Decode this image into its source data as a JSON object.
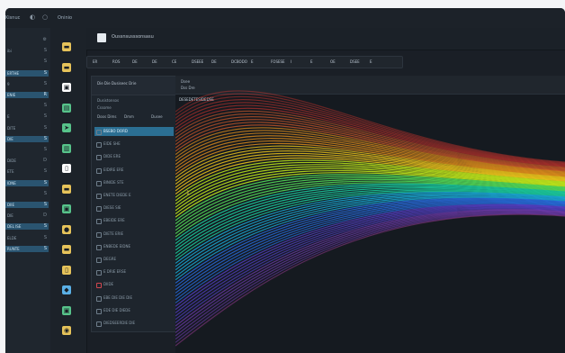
{
  "topbar": {
    "left_label": "Kisnuc",
    "center_label": "Oninio",
    "icons": [
      "moon-icon",
      "circle-icon"
    ]
  },
  "left_nav": {
    "items": [
      {
        "label": "",
        "icon": "gear-icon",
        "highlight": false
      },
      {
        "label": "ibi",
        "icon": "S",
        "highlight": false
      },
      {
        "label": "",
        "icon": "S",
        "highlight": false
      },
      {
        "label": "ERTHE",
        "icon": "S",
        "highlight": true
      },
      {
        "label": "9",
        "icon": "S",
        "highlight": false
      },
      {
        "label": "ENIE",
        "icon": "R",
        "highlight": true
      },
      {
        "label": "",
        "icon": "S",
        "highlight": false
      },
      {
        "label": "E",
        "icon": "S",
        "highlight": false
      },
      {
        "label": "DITE",
        "icon": "S",
        "highlight": false
      },
      {
        "label": "DIE",
        "icon": "S",
        "highlight": true
      },
      {
        "label": "",
        "icon": "S",
        "highlight": false
      },
      {
        "label": "DIDE",
        "icon": "D",
        "highlight": false
      },
      {
        "label": "ETE",
        "icon": "S",
        "highlight": false
      },
      {
        "label": "IDNE",
        "icon": "S",
        "highlight": true
      },
      {
        "label": "",
        "icon": "S",
        "highlight": false
      },
      {
        "label": "DIIE",
        "icon": "S",
        "highlight": true
      },
      {
        "label": "DIE",
        "icon": "D",
        "highlight": false
      },
      {
        "label": "DEL ISE",
        "icon": "S",
        "highlight": true
      },
      {
        "label": "ELDE",
        "icon": "S",
        "highlight": false
      },
      {
        "label": "RUNTE",
        "icon": "S",
        "highlight": true
      }
    ]
  },
  "tool_strip": {
    "tools": [
      {
        "icon": "folder-icon",
        "color": "#e6c35a"
      },
      {
        "icon": "folder-icon",
        "color": "#e6c35a"
      },
      {
        "icon": "image-icon",
        "color": "#ffffff"
      },
      {
        "icon": "picture-icon",
        "color": "#57c38a"
      },
      {
        "icon": "arrow-icon",
        "color": "#57c38a"
      },
      {
        "icon": "photo-icon",
        "color": "#57c38a"
      },
      {
        "icon": "document-icon",
        "color": "#ffffff"
      },
      {
        "icon": "folder-icon",
        "color": "#e6c35a"
      },
      {
        "icon": "image-icon",
        "color": "#57c38a"
      },
      {
        "icon": "coin-icon",
        "color": "#e6c35a"
      },
      {
        "icon": "folder-icon",
        "color": "#e6c35a"
      },
      {
        "icon": "document-icon",
        "color": "#e6c35a"
      },
      {
        "icon": "blue-file-icon",
        "color": "#5ab0e6"
      },
      {
        "icon": "image-icon",
        "color": "#57c38a"
      },
      {
        "icon": "camera-icon",
        "color": "#e6c35a"
      }
    ]
  },
  "main": {
    "title": "Oussnsusssonsasu",
    "filters": [
      "ER",
      "ROS",
      "DE",
      "DE",
      "CE",
      "DSEEE",
      "DE",
      "DCBODO",
      "E",
      "FOSESE",
      "I",
      "E",
      "OE",
      "DSEE",
      "E"
    ]
  },
  "panel": {
    "title": "Die Die Dusiseec Drie",
    "subtitle": "Dusistonsos",
    "sub2": "Cssome",
    "tabs": [
      "Doos Dims",
      "Dmm",
      "Dusee"
    ],
    "rows": [
      {
        "label": "BSEBO DORD",
        "selected": true
      },
      {
        "label": "EIDE SHE",
        "selected": false
      },
      {
        "label": "DIDE ERE",
        "selected": false
      },
      {
        "label": "EIDIRE ERE",
        "selected": false
      },
      {
        "label": "BINIDE STE",
        "selected": false
      },
      {
        "label": "ENETE DIEDE E",
        "selected": false
      },
      {
        "label": "DIESE SIE",
        "selected": false
      },
      {
        "label": "EBEIDE ERE",
        "selected": false
      },
      {
        "label": "DIETE ERIE",
        "selected": false
      },
      {
        "label": "ENBEDE EIDNE",
        "selected": false
      },
      {
        "label": "DEGRE",
        "selected": false
      },
      {
        "label": "E DRIE ERSE",
        "selected": false
      },
      {
        "label": "DIIDE",
        "selected": false
      },
      {
        "label": "EBE DIE DIE DIE",
        "selected": false
      },
      {
        "label": "EDE DIE DIEDE",
        "selected": false
      },
      {
        "label": "DIEDSEERDIE DIE",
        "selected": false
      }
    ]
  },
  "canvas": {
    "header_left": "Dsee",
    "header_sub": "Dss Dre",
    "header_label": "DESEDETESIDEDSE",
    "marker": "1"
  }
}
